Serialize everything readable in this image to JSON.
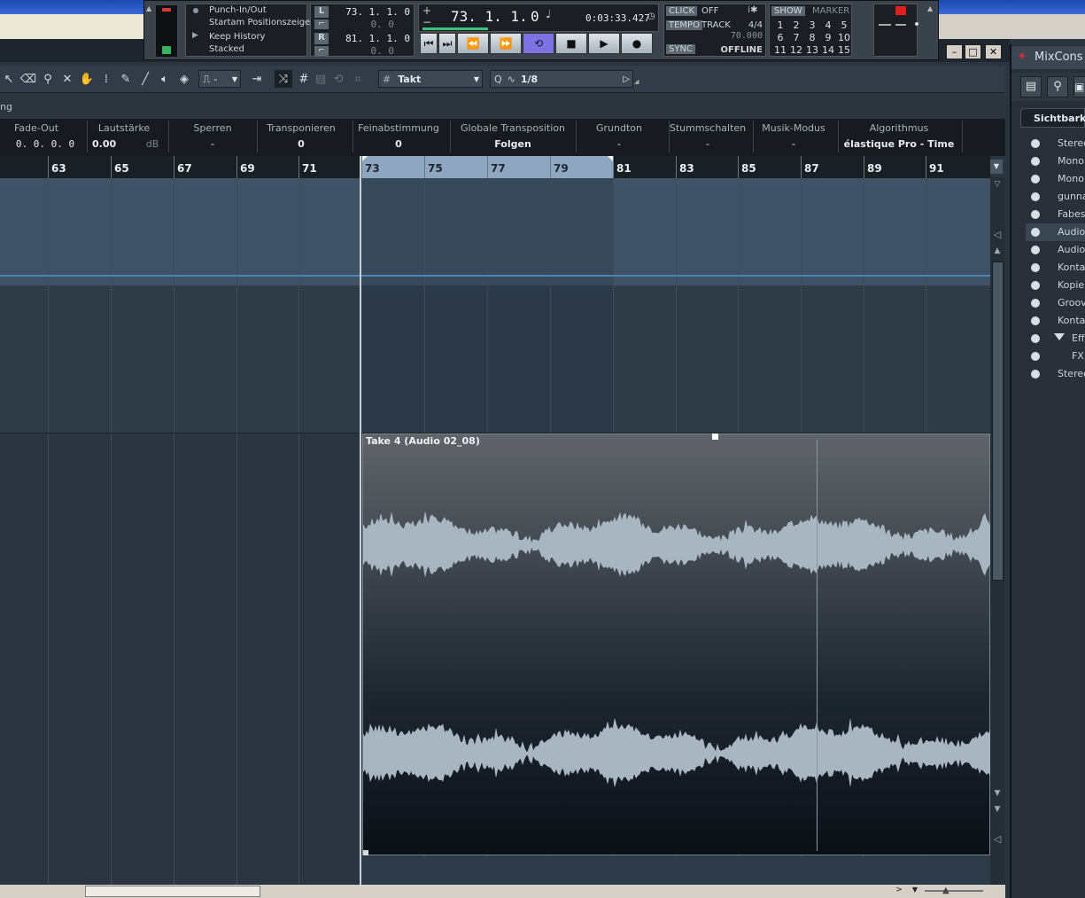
{
  "transport": {
    "punch_label": "Punch-In/Out",
    "start_label": "Startam Positionszeiger",
    "keep_label": "Keep History",
    "stacked_label": "Stacked",
    "locator_l_label": "L",
    "locator_r_label": "R",
    "locator_l_value": "73. 1. 1.   0",
    "locator_l_sub": "0.   0",
    "locator_r_value": "81. 1. 1.   0",
    "locator_r_sub": "0.   0",
    "position_bars": "73. 1. 1.",
    "position_ticks": "0",
    "position_time": "0:03:33.427",
    "click_label": "CLICK",
    "click_value": "OFF",
    "tempo_label": "TEMPO",
    "tempo_mode": "TRACK",
    "signature": "4/4",
    "tempo_value": "70.000",
    "sync_label": "SYNC",
    "sync_value": "OFFLINE",
    "show_label": "SHOW",
    "marker_label": "MARKER",
    "marker_numbers": [
      "1",
      "2",
      "3",
      "4",
      "5",
      "6",
      "7",
      "8",
      "9",
      "10",
      "11",
      "12",
      "13",
      "14",
      "15"
    ],
    "accent": "#6b5fd3"
  },
  "toolbar": {
    "snap_type": "Takt",
    "quantize_value": "1/8",
    "snap_mode": "-"
  },
  "strip2": {
    "partial_label": "ng"
  },
  "infoline": {
    "headers": [
      "Fade-Out",
      "Lautstärke",
      "Sperren",
      "Transponieren",
      "Feinabstimmung",
      "Globale Transposition",
      "Grundton",
      "Stummschalten",
      "Musik-Modus",
      "Algorithmus"
    ],
    "values": [
      "0. 0. 0.   0",
      "0.00",
      "-",
      "0",
      "0",
      "Folgen",
      "-",
      "-",
      "-",
      "élastique Pro - Time"
    ],
    "unit_db": "dB"
  },
  "ruler": {
    "bars": [
      "63",
      "65",
      "67",
      "69",
      "71",
      "73",
      "75",
      "77",
      "79",
      "81",
      "83",
      "85",
      "87",
      "89",
      "91"
    ]
  },
  "event": {
    "title": "Take 4 (Audio 02_08)"
  },
  "mixconsole": {
    "title": "MixCons",
    "tab": "Sichtbarkei",
    "rows": [
      "Stereo",
      "Mono",
      "Mono",
      "gunna",
      "Fabes",
      "Audio",
      "Audio",
      "Konta",
      "Kopie",
      "Groov",
      "Konta",
      "Eff",
      "FX",
      "Stereo"
    ]
  }
}
